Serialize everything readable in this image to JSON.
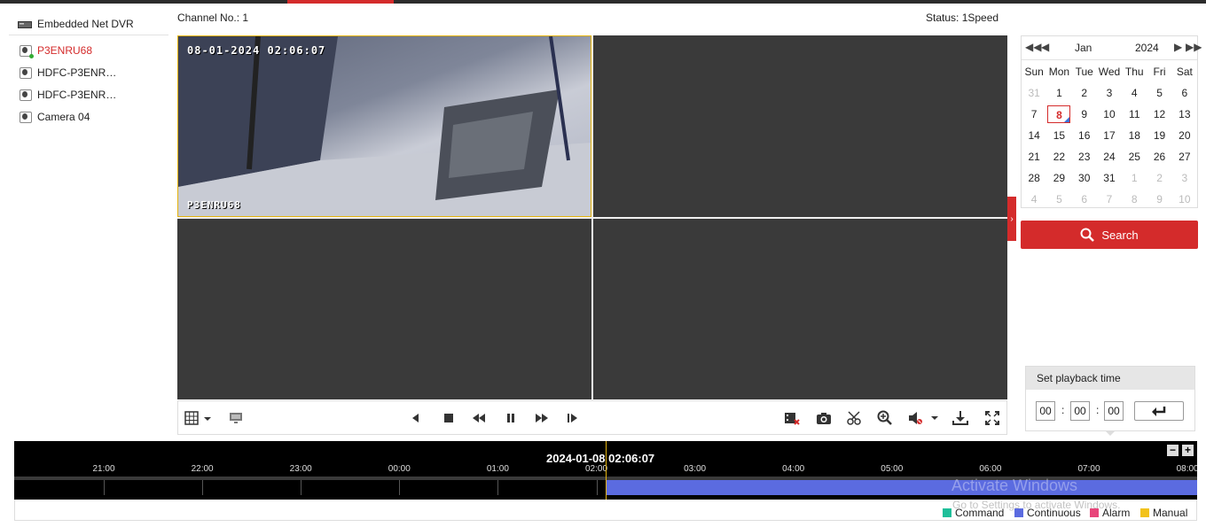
{
  "header": {
    "dvr_name": "Embedded Net DVR",
    "channel_no": "Channel No.: 1",
    "status": "Status: 1Speed"
  },
  "cameras": [
    {
      "label": "P3ENRU68",
      "active": true
    },
    {
      "label": "HDFC-P3ENR…",
      "active": false
    },
    {
      "label": "HDFC-P3ENR…",
      "active": false
    },
    {
      "label": "Camera 04",
      "active": false
    }
  ],
  "video": {
    "osd_datetime": "08-01-2024 02:06:07",
    "osd_name": "P3ENRU68"
  },
  "calendar": {
    "month": "Jan",
    "year": "2024",
    "weekdays": [
      "Sun",
      "Mon",
      "Tue",
      "Wed",
      "Thu",
      "Fri",
      "Sat"
    ],
    "weeks": [
      [
        "31",
        "1",
        "2",
        "3",
        "4",
        "5",
        "6"
      ],
      [
        "7",
        "8",
        "9",
        "10",
        "11",
        "12",
        "13"
      ],
      [
        "14",
        "15",
        "16",
        "17",
        "18",
        "19",
        "20"
      ],
      [
        "21",
        "22",
        "23",
        "24",
        "25",
        "26",
        "27"
      ],
      [
        "28",
        "29",
        "30",
        "31",
        "1",
        "2",
        "3"
      ],
      [
        "4",
        "5",
        "6",
        "7",
        "8",
        "9",
        "10"
      ]
    ],
    "selected_day": "8"
  },
  "search": {
    "label": "Search"
  },
  "playback_time": {
    "title": "Set playback time",
    "hh": "00",
    "mm": "00",
    "ss": "00"
  },
  "timeline": {
    "current": "2024-01-08 02:06:07",
    "ticks": [
      "21:00",
      "22:00",
      "23:00",
      "00:00",
      "01:00",
      "02:00",
      "03:00",
      "04:00",
      "05:00",
      "06:00",
      "07:00",
      "08:00"
    ]
  },
  "legend": [
    {
      "label": "Command",
      "color": "#1fbf9a"
    },
    {
      "label": "Continuous",
      "color": "#5b6be0"
    },
    {
      "label": "Alarm",
      "color": "#e8457a"
    },
    {
      "label": "Manual",
      "color": "#f2c21b"
    }
  ],
  "watermark": {
    "line1": "Activate Windows",
    "line2": "Go to Settings to activate Windows."
  },
  "colors": {
    "accent": "#d42b2b",
    "selection": "#e3b30f",
    "record": "#5b6be0"
  }
}
